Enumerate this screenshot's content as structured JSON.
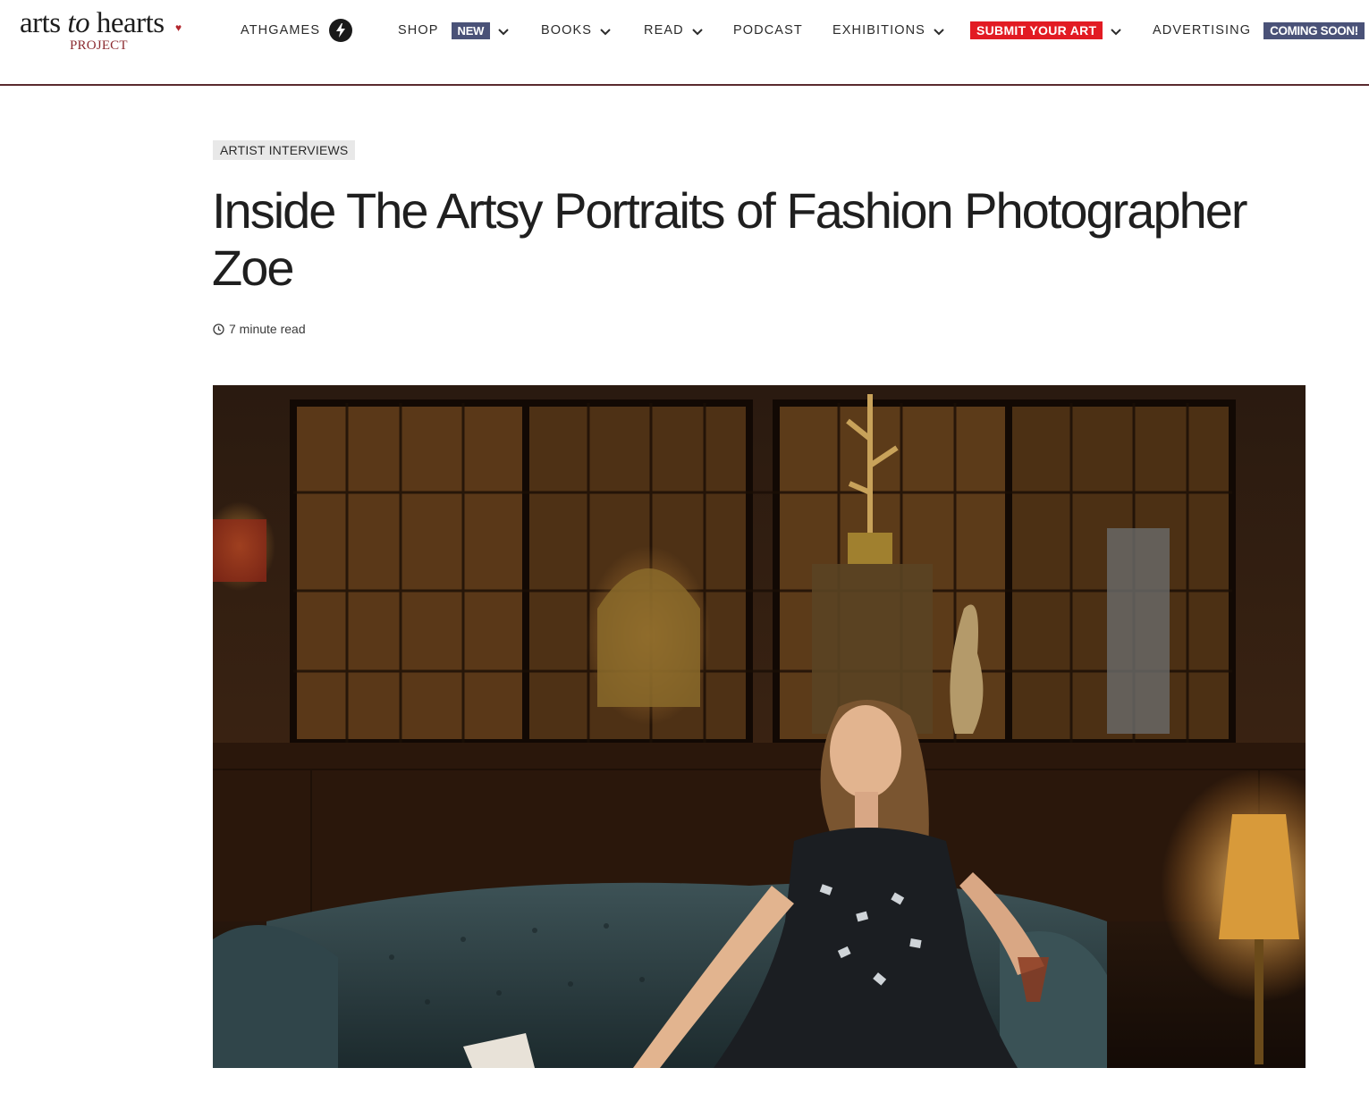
{
  "logo": {
    "part1": "arts ",
    "part2": "to",
    "part3": " hearts",
    "sub": "PROJECT"
  },
  "nav": {
    "athgames": "ATHGAMES",
    "shop": "SHOP",
    "shop_badge": "NEW",
    "books": "BOOKS",
    "read": "READ",
    "podcast": "PODCAST",
    "exhibitions": "EXHIBITIONS",
    "submit": "SUBMIT YOUR ART",
    "advertising": "ADVERTISING",
    "advertising_badge": "COMING SOON!"
  },
  "article": {
    "category": "ARTIST INTERVIEWS",
    "title": "Inside The Artsy Portraits of Fashion Photographer Zoe",
    "read_time": "7 minute read"
  },
  "colors": {
    "accent_red": "#e21b23",
    "badge_blue": "#4a5278",
    "header_rule": "#5a2a2f"
  },
  "icons": [
    "heart-icon",
    "bolt-icon",
    "chevron-down-icon",
    "clock-icon"
  ]
}
